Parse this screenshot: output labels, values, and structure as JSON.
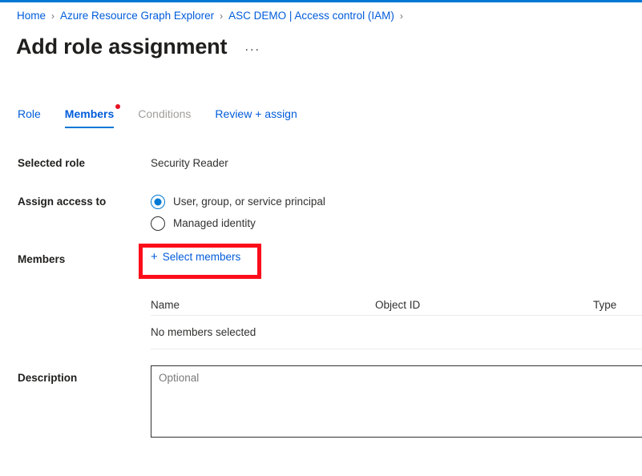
{
  "theme": {
    "accent": "#0078d4",
    "link": "#015cda",
    "text": "#201f1e",
    "muted": "#a19f9d",
    "highlight": "#fc0d1b",
    "border": "#edebe9"
  },
  "breadcrumb": {
    "separator": "›",
    "items": [
      {
        "label": "Home"
      },
      {
        "label": "Azure Resource Graph Explorer"
      },
      {
        "label": "ASC DEMO | Access control (IAM)"
      }
    ]
  },
  "header": {
    "title": "Add role assignment",
    "more_menu": "···",
    "more_menu_icon": "ellipsis-icon"
  },
  "tabs": [
    {
      "label": "Role",
      "state": "enabled"
    },
    {
      "label": "Members",
      "state": "active",
      "badge": "required-dot"
    },
    {
      "label": "Conditions",
      "state": "disabled"
    },
    {
      "label": "Review + assign",
      "state": "enabled"
    }
  ],
  "form": {
    "selected_role": {
      "label": "Selected role",
      "value": "Security Reader"
    },
    "assign_access_to": {
      "label": "Assign access to",
      "options": [
        {
          "label": "User, group, or service principal",
          "checked": true
        },
        {
          "label": "Managed identity",
          "checked": false
        }
      ]
    },
    "members": {
      "label": "Members",
      "select_button": "Select members",
      "plus_icon": "+",
      "table": {
        "columns": [
          "Name",
          "Object ID",
          "Type"
        ],
        "empty_message": "No members selected",
        "rows": []
      }
    },
    "description": {
      "label": "Description",
      "placeholder": "Optional",
      "value": ""
    }
  }
}
